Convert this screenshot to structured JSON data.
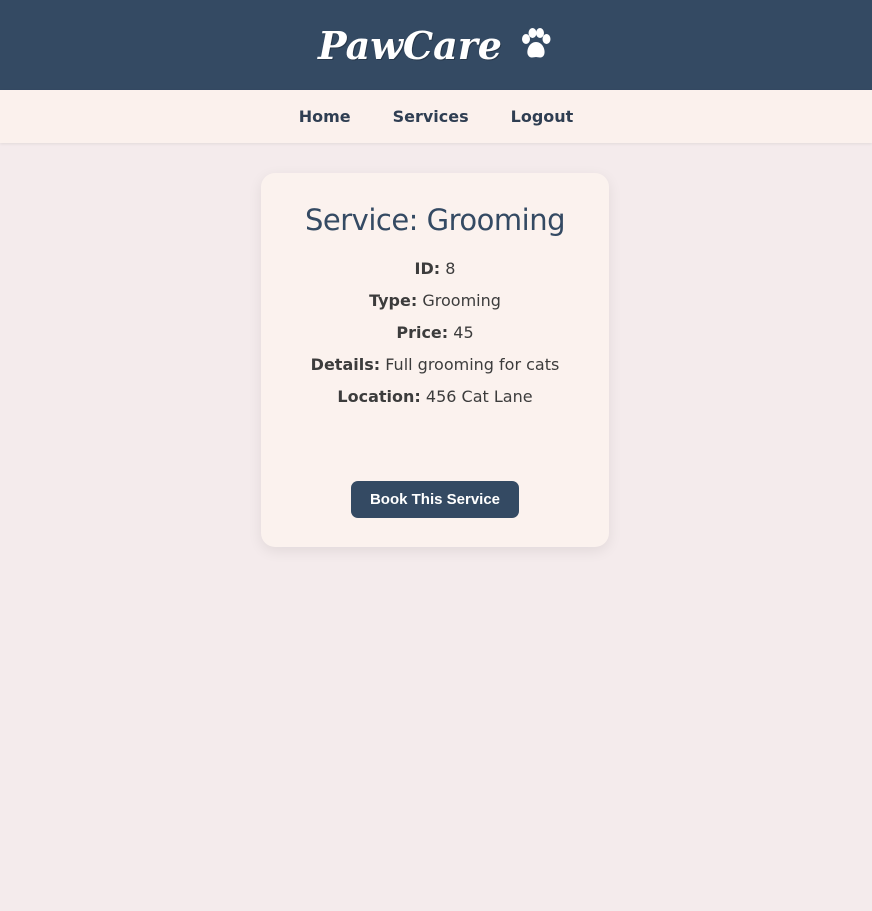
{
  "header": {
    "brand": "PawCare",
    "logo_icon": "paw-icon"
  },
  "nav": {
    "items": [
      {
        "label": "Home"
      },
      {
        "label": "Services"
      },
      {
        "label": "Logout"
      }
    ]
  },
  "service": {
    "title": "Service: Grooming",
    "fields": [
      {
        "label": "ID:",
        "value": "8"
      },
      {
        "label": "Type:",
        "value": "Grooming"
      },
      {
        "label": "Price:",
        "value": "45"
      },
      {
        "label": "Details:",
        "value": "Full grooming for cats"
      },
      {
        "label": "Location:",
        "value": "456 Cat Lane"
      }
    ],
    "book_button": "Book This Service"
  },
  "colors": {
    "header_bg": "#344a63",
    "nav_bg": "#fbf1ed",
    "page_bg": "#f4ebec",
    "card_bg": "#fbf2ee",
    "button_bg": "#344a63"
  }
}
